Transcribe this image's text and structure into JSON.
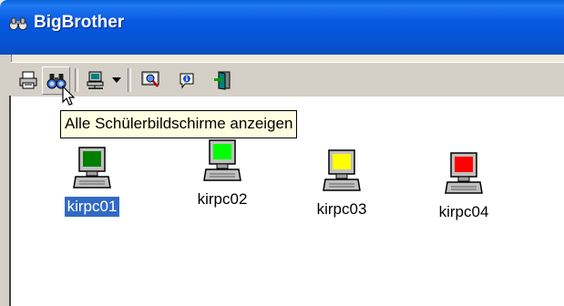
{
  "window": {
    "title": "BigBrother",
    "title_icon": "binoculars-icon"
  },
  "toolbar": {
    "buttons": [
      {
        "name": "print-icon"
      },
      {
        "name": "binoculars-icon",
        "state": "hover"
      },
      {
        "name": "network-computer-icon",
        "has_dropdown": true
      },
      {
        "name": "magnifier-icon"
      },
      {
        "name": "info-icon"
      },
      {
        "name": "exit-door-icon"
      }
    ]
  },
  "tooltip": {
    "text": "Alle Schülerbildschirme anzeigen"
  },
  "computers": [
    {
      "label": "kirpc01",
      "screen_color": "#008000",
      "selected": true
    },
    {
      "label": "kirpc02",
      "screen_color": "#00ff00",
      "selected": false
    },
    {
      "label": "kirpc03",
      "screen_color": "#ffff00",
      "selected": false
    },
    {
      "label": "kirpc04",
      "screen_color": "#ff0000",
      "selected": false
    }
  ],
  "colors": {
    "title_bar": "#0454d6",
    "selection": "#316ac5",
    "tooltip_bg": "#ffffe1"
  }
}
